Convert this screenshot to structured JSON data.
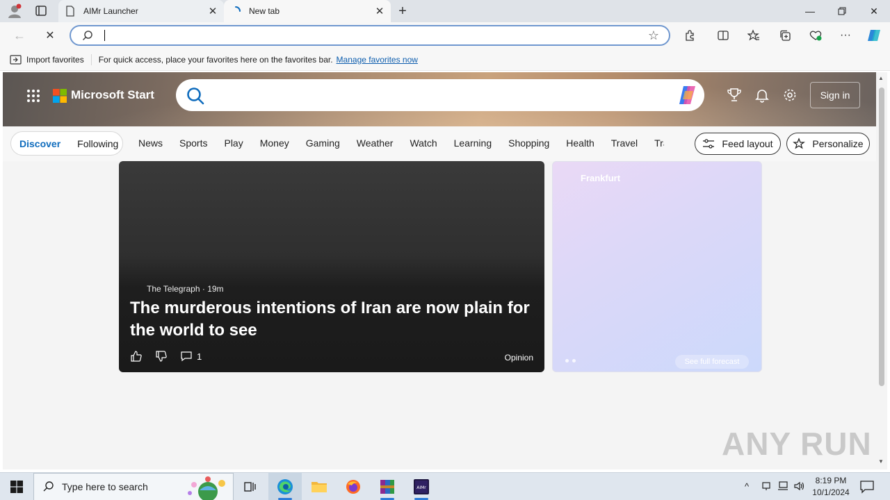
{
  "browser": {
    "tabs": [
      {
        "title": "AIMr Launcher",
        "active": false
      },
      {
        "title": "New tab",
        "active": true
      }
    ],
    "address": {
      "value": "",
      "placeholder": ""
    }
  },
  "favorites_bar": {
    "import_label": "Import favorites",
    "message": "For quick access, place your favorites here on the favorites bar.",
    "manage_link": "Manage favorites now"
  },
  "start_page": {
    "brand": "Microsoft Start",
    "signin_label": "Sign in",
    "pills": [
      "Discover",
      "Following"
    ],
    "categories": [
      "News",
      "Sports",
      "Play",
      "Money",
      "Gaming",
      "Weather",
      "Watch",
      "Learning",
      "Shopping",
      "Health",
      "Travel",
      "Traf"
    ],
    "feed_layout_label": "Feed layout",
    "personalize_label": "Personalize",
    "article": {
      "source": "The Telegraph",
      "age": "19m",
      "headline": "The murderous intentions of Iran are now plain for the world to see",
      "comments": "1",
      "tag": "Opinion"
    },
    "weather": {
      "city": "Frankfurt",
      "forecast_label": "See full forecast"
    }
  },
  "watermark": "ANY RUN",
  "taskbar": {
    "search_placeholder": "Type here to search",
    "time": "8:19 PM",
    "date": "10/1/2024"
  },
  "colors": {
    "accent": "#0f6cbd",
    "omnibox_border": "#6f97cf",
    "link": "#0b5cad"
  }
}
